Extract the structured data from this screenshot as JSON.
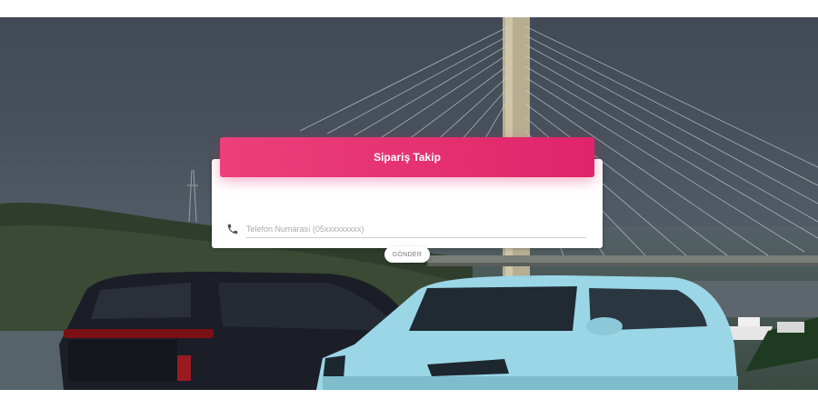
{
  "order_tracking": {
    "title": "Sipariş Takip",
    "phone_placeholder": "Telefon Numarası (05xxxxxxxxx)",
    "submit_label": "GÖNDER"
  },
  "background": {
    "description_icon": "bridge-and-cars-photo"
  },
  "colors": {
    "accent": "#e91e63",
    "card": "#ffffff"
  },
  "icons": {
    "phone": "phone-icon"
  }
}
